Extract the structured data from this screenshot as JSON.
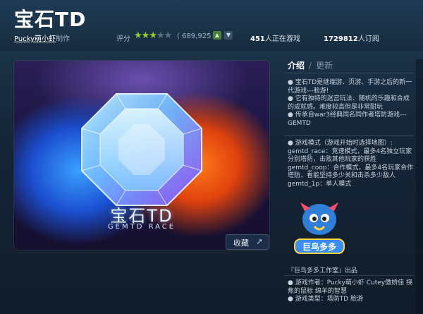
{
  "game": {
    "title": "宝石TD",
    "author_name": "Pucky萌小虾",
    "author_suffix": "制作"
  },
  "rating": {
    "label": "评分",
    "stars_filled": 3,
    "stars_total": 5,
    "count": "( 689,925 )"
  },
  "stats": {
    "playing_count": "451",
    "playing_label": "人正在游戏",
    "subscribers_count": "1729812",
    "subscribers_label": "人订阅"
  },
  "hero": {
    "title": "宝石TD",
    "subtitle": "GEMTD RACE"
  },
  "actions": {
    "collect_label": "收藏"
  },
  "tabs": [
    {
      "label": "介绍",
      "active": true
    },
    {
      "label": "更新",
      "active": false
    }
  ],
  "tab_separator": "/",
  "description": [
    "● 宝石TD是继端游、页游、手游之后的新一代游戏---脸游!",
    "● 它有独特的迷宫玩法、随机的乐趣和合成的成就感。难度较高但是非常耐玩",
    "● 传承自war3经典同名同作者塔防游戏---GEMTD"
  ],
  "modes": [
    "● 游戏模式（游戏开始时选择地图）:",
    "gemtd_race：竞速模式，最多4名独立玩家分别塔防，击败其他玩家的获胜",
    "gemtd_coop：合作模式，最多4名玩家合作塔防，看能坚持多少关和击杀多少敌人",
    "gemtd_1p：单人模式"
  ],
  "studio_logo_text": "巨鸟多多",
  "credit": "『巨鸟多多工作室』出品",
  "info": [
    "● 游戏作者：Pucky萌小虾 Cutey傲娇佳 挠焦的鼠标 绵羊的智慧",
    "● 游戏类型：塔防TD 脸游"
  ],
  "colors": {
    "accent_green": "#9acd32",
    "background": "#16273a"
  }
}
